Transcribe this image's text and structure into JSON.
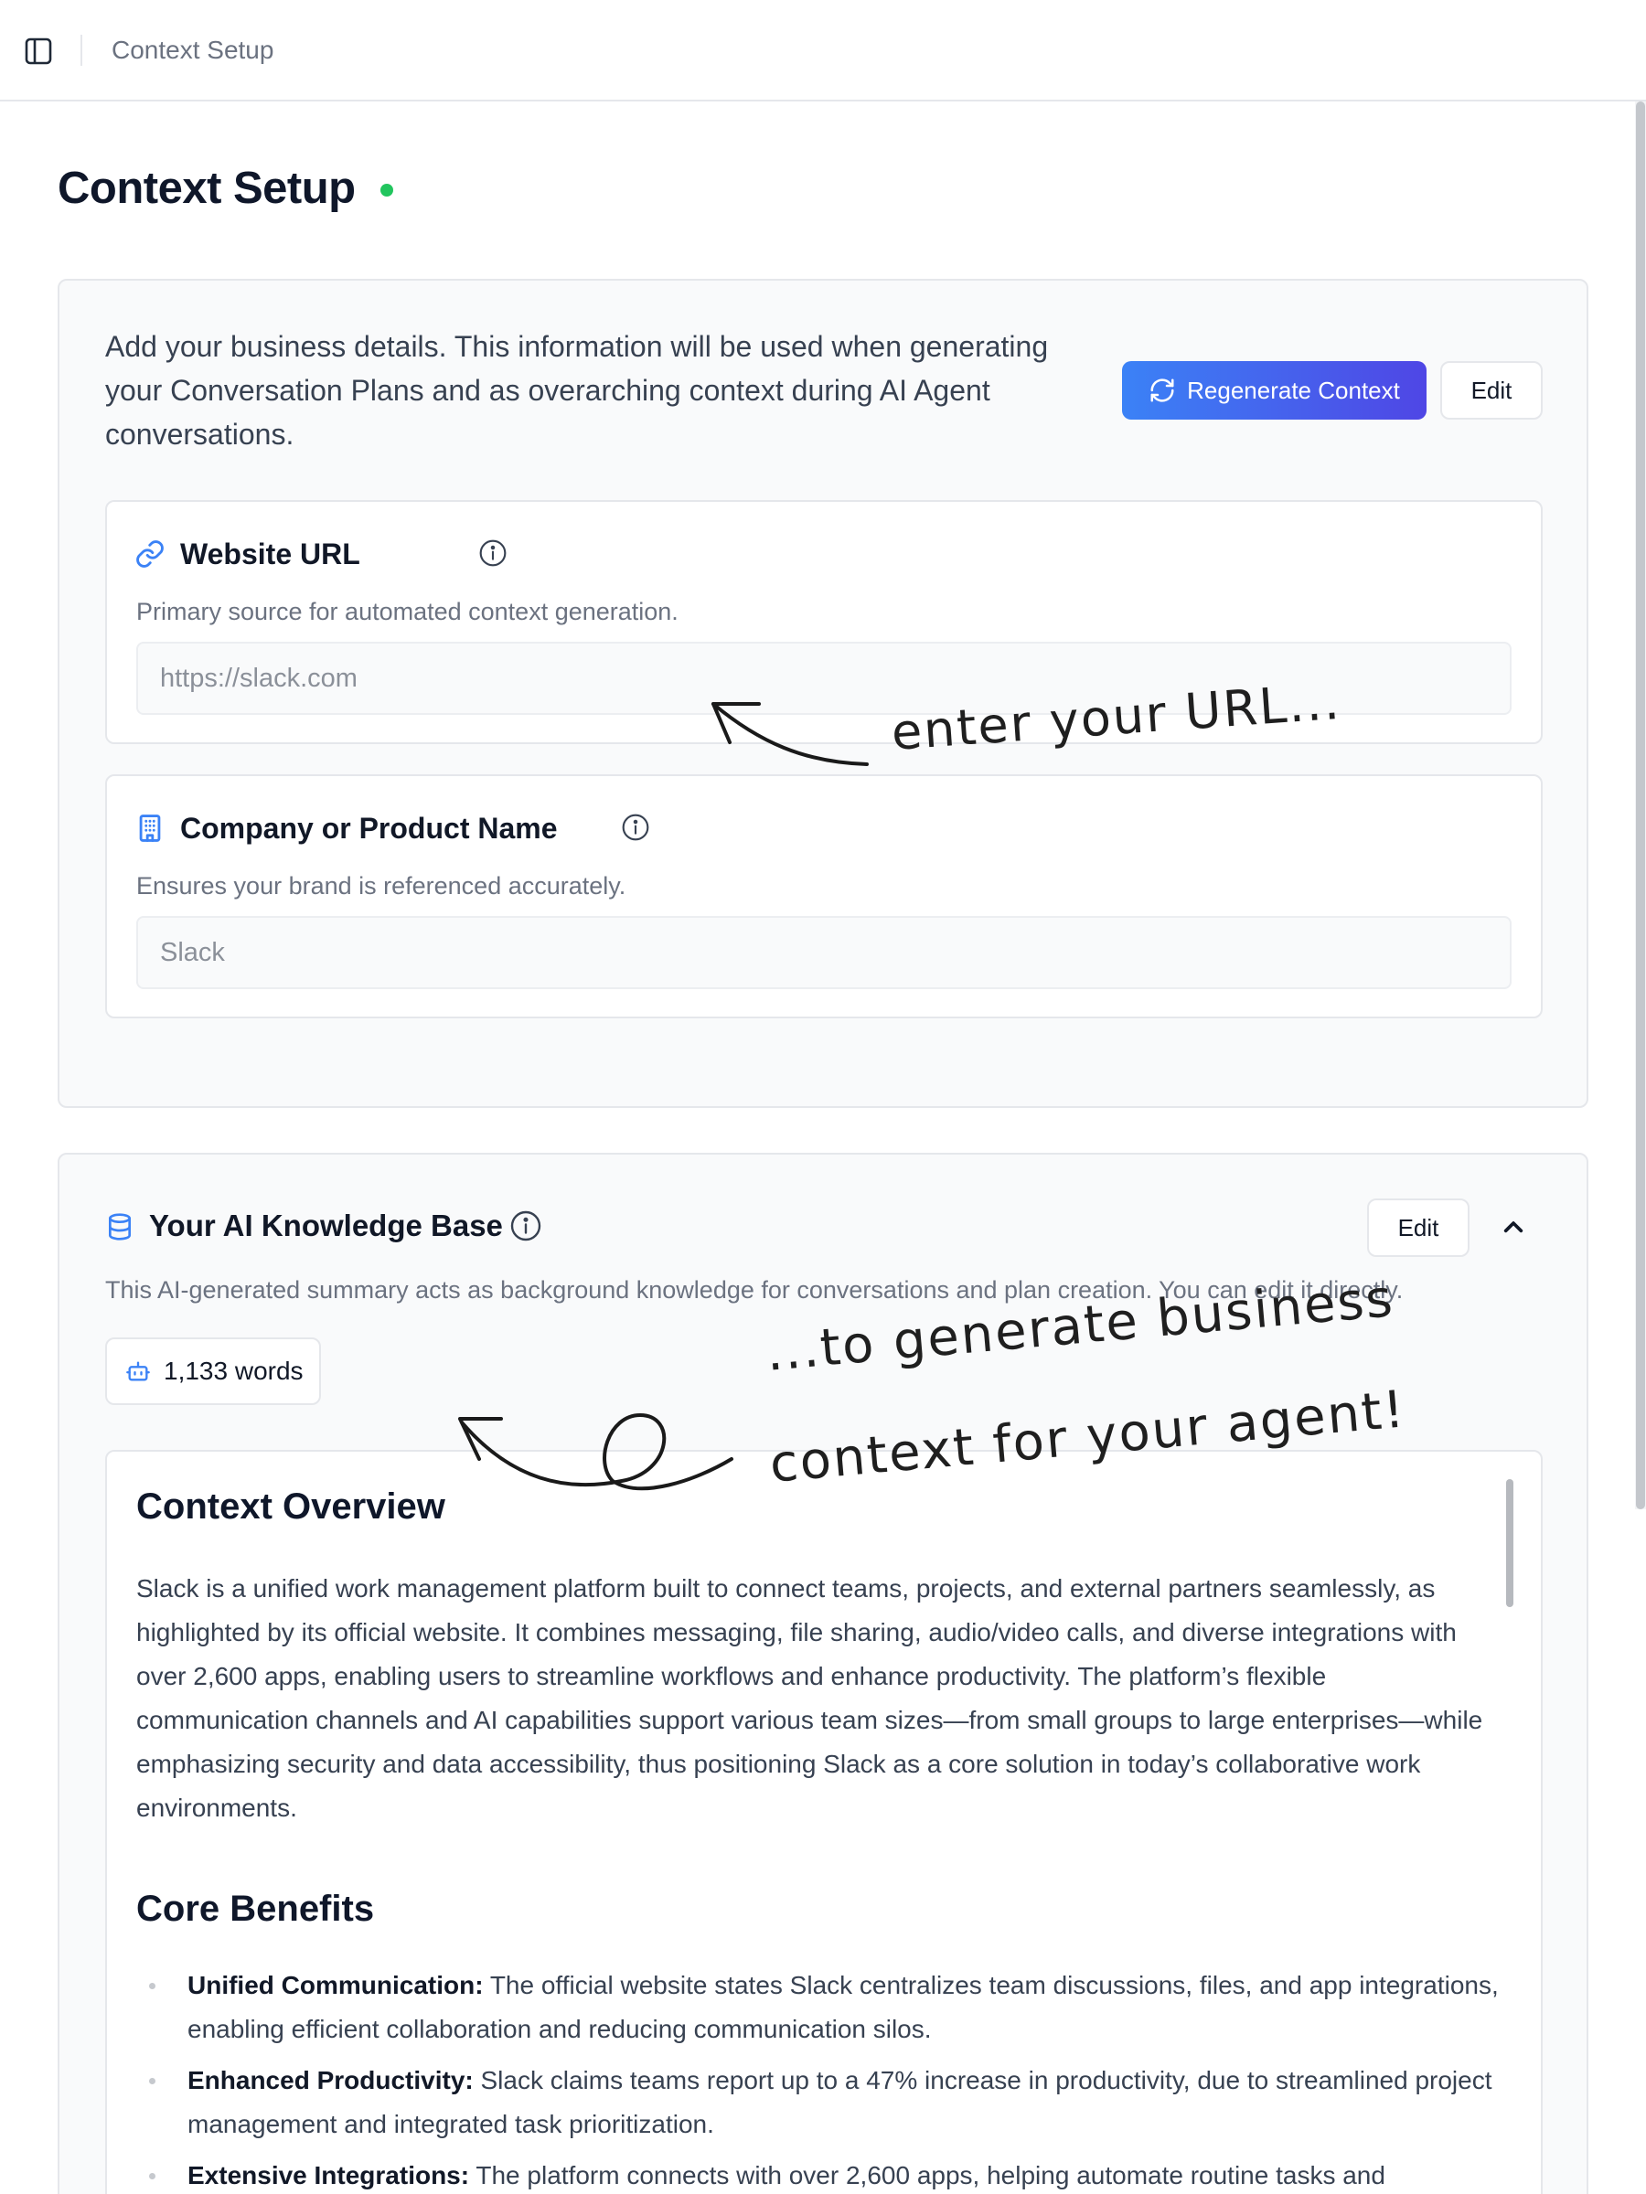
{
  "topbar": {
    "title": "Context Setup"
  },
  "page": {
    "title": "Context Setup",
    "status_color": "#22c55e"
  },
  "setup_card": {
    "intro": "Add your business details. This information will be used when generating your Conversation Plans and as overarching context during AI Agent conversations.",
    "regenerate_label": "Regenerate Context",
    "edit_label": "Edit",
    "website": {
      "label": "Website URL",
      "help": "Primary source for automated context generation.",
      "placeholder": "https://slack.com"
    },
    "company": {
      "label": "Company or Product Name",
      "help": "Ensures your brand is referenced accurately.",
      "placeholder": "Slack"
    }
  },
  "knowledge_base": {
    "title": "Your AI Knowledge Base",
    "edit_label": "Edit",
    "description": "This AI-generated summary acts as background knowledge for conversations and plan creation. You can edit it directly.",
    "word_count": "1,133 words",
    "doc": {
      "overview_heading": "Context Overview",
      "overview_text": "Slack is a unified work management platform built to connect teams, projects, and external partners seamlessly, as highlighted by its official website. It combines messaging, file sharing, audio/video calls, and diverse integrations with over 2,600 apps, enabling users to streamline workflows and enhance productivity. The platform’s flexible communication channels and AI capabilities support various team sizes—from small groups to large enterprises—while emphasizing security and data accessibility, thus positioning Slack as a core solution in today’s collaborative work environments.",
      "benefits_heading": "Core Benefits",
      "benefits": [
        {
          "title": "Unified Communication:",
          "text": " The official website states Slack centralizes team discussions, files, and app integrations, enabling efficient collaboration and reducing communication silos."
        },
        {
          "title": "Enhanced Productivity:",
          "text": " Slack claims teams report up to a 47% increase in productivity, due to streamlined project management and integrated task prioritization."
        },
        {
          "title": "Extensive Integrations:",
          "text": " The platform connects with over 2,600 apps, helping automate routine tasks and"
        }
      ]
    }
  },
  "annotations": {
    "url_note": "enter your URL...",
    "generate_note_line1": "...to generate business",
    "generate_note_line2": "context for your agent!"
  },
  "colors": {
    "accent_start": "#3b82f6",
    "accent_end": "#4f46e5",
    "icon_blue": "#3b82f6"
  }
}
